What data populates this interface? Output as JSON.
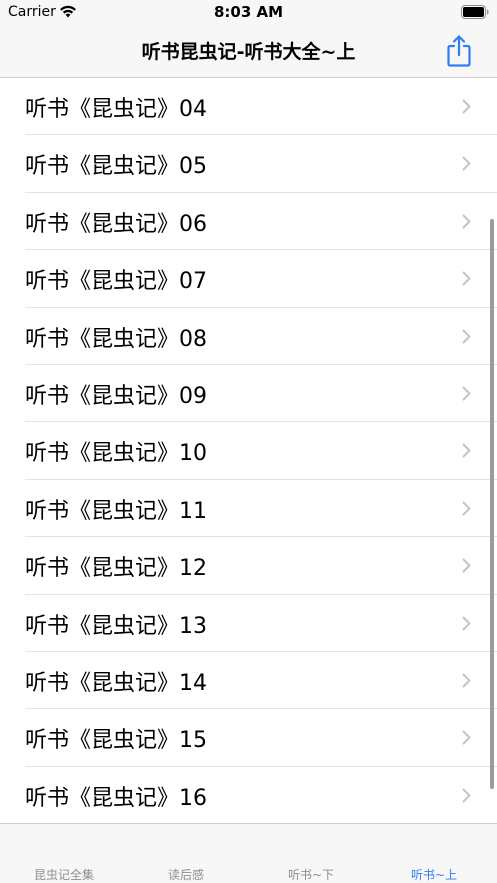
{
  "status_bar": {
    "carrier": "Carrier",
    "time": "8:03 AM"
  },
  "nav": {
    "title": "听书昆虫记-听书大全~上",
    "share_icon": "share-icon",
    "accent_color": "#2f7cf6"
  },
  "list": {
    "items": [
      {
        "label": "听书《昆虫记》04"
      },
      {
        "label": "听书《昆虫记》05"
      },
      {
        "label": "听书《昆虫记》06"
      },
      {
        "label": "听书《昆虫记》07"
      },
      {
        "label": "听书《昆虫记》08"
      },
      {
        "label": "听书《昆虫记》09"
      },
      {
        "label": "听书《昆虫记》10"
      },
      {
        "label": "听书《昆虫记》11"
      },
      {
        "label": "听书《昆虫记》12"
      },
      {
        "label": "听书《昆虫记》13"
      },
      {
        "label": "听书《昆虫记》14"
      },
      {
        "label": "听书《昆虫记》15"
      },
      {
        "label": "听书《昆虫记》16"
      }
    ]
  },
  "tab_bar": {
    "tabs": [
      {
        "label": "昆虫记全集",
        "active": false
      },
      {
        "label": "读后感",
        "active": false
      },
      {
        "label": "听书~下",
        "active": false
      },
      {
        "label": "听书~上",
        "active": true
      }
    ]
  }
}
